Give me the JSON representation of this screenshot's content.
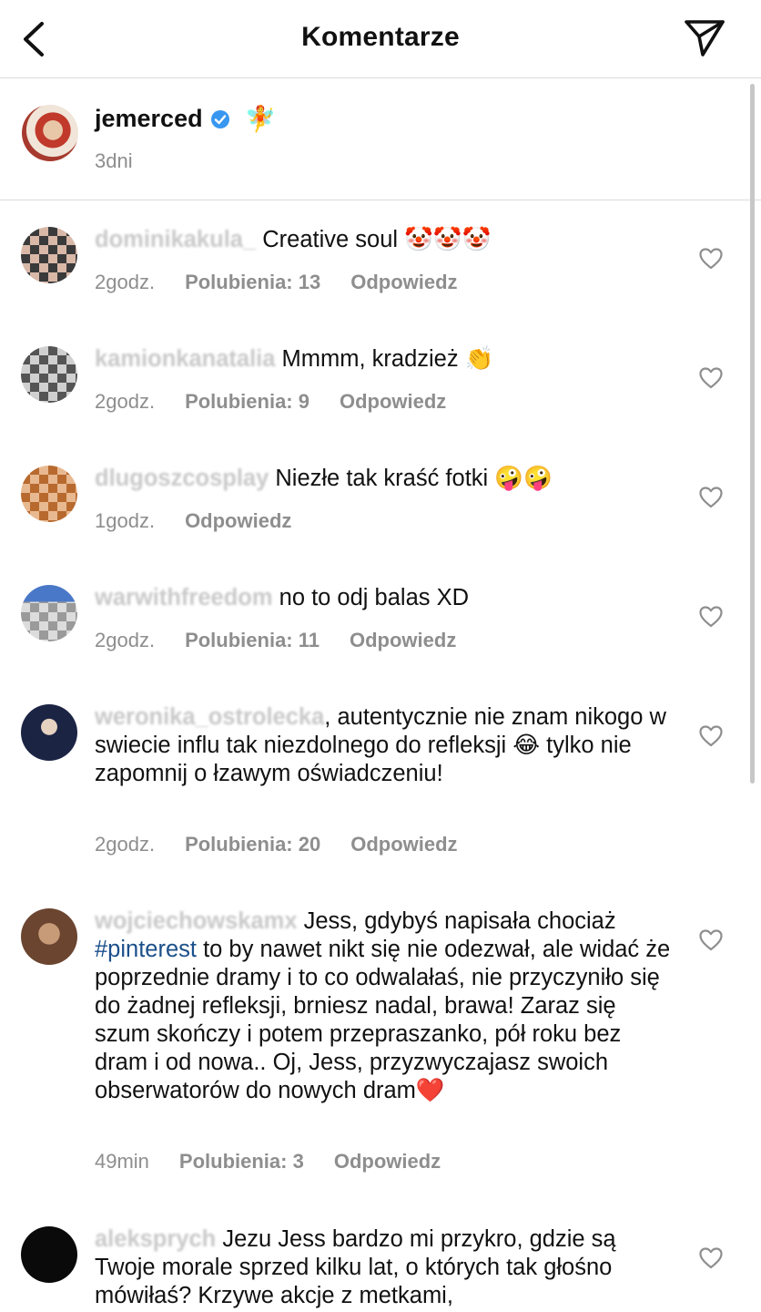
{
  "header": {
    "title": "Komentarze",
    "back_icon": "chevron-left-icon",
    "send_icon": "paper-plane-icon"
  },
  "post": {
    "username": "jemerced",
    "emoji": "🧚",
    "time": "3dni"
  },
  "comments": [
    {
      "username": "dominikakula_",
      "text": " Creative soul 🤡🤡🤡",
      "time": "2godz.",
      "likes": "Polubienia: 13",
      "reply": "Odpowiedz"
    },
    {
      "username": "kamionkanatalia",
      "text": " Mmmm, kradzież 👏",
      "time": "2godz.",
      "likes": "Polubienia: 9",
      "reply": "Odpowiedz"
    },
    {
      "username": "dlugoszcosplay",
      "text": " Niezłe tak kraść fotki 🤪🤪",
      "time": "1godz.",
      "likes": "",
      "reply": "Odpowiedz"
    },
    {
      "username": "warwithfreedom",
      "text": " no to odj  balas XD",
      "time": "2godz.",
      "likes": "Polubienia: 11",
      "reply": "Odpowiedz"
    },
    {
      "username": "weronika_ostrolecka",
      "text": ", autentycznie nie znam nikogo w swiecie influ tak niezdolnego do refleksji 😂 tylko nie zapomnij o łzawym oświadczeniu!",
      "time": "2godz.",
      "likes": "Polubienia: 20",
      "reply": "Odpowiedz"
    },
    {
      "username": "wojciechowskamx",
      "text_a": " Jess, gdybyś napisała chociaż ",
      "hashtag": "#pinterest",
      "text_b": "  to by nawet nikt się nie odezwał, ale widać że poprzednie dramy i to co odwalałaś, nie przyczyniło się do żadnej refleksji, brniesz nadal, brawa! Zaraz się szum skończy i potem przepraszanko, pół roku bez dram i od nowa.. Oj, Jess, przyzwyczajasz swoich obserwatorów do nowych dram❤️",
      "time": "49min",
      "likes": "Polubienia: 3",
      "reply": "Odpowiedz"
    },
    {
      "username": "aleksprych",
      "text": " Jezu Jess bardzo mi przykro, gdzie są Twoje morale sprzed  kilku lat, o których tak głośno mówiłaś? Krzywe akcje z metkami,",
      "time": "",
      "likes": "",
      "reply": ""
    }
  ],
  "colors": {
    "muted": "#8e8e8e",
    "hashtag": "#1a4f8a",
    "divider": "#dbdbdb",
    "verified": "#3897f0"
  }
}
